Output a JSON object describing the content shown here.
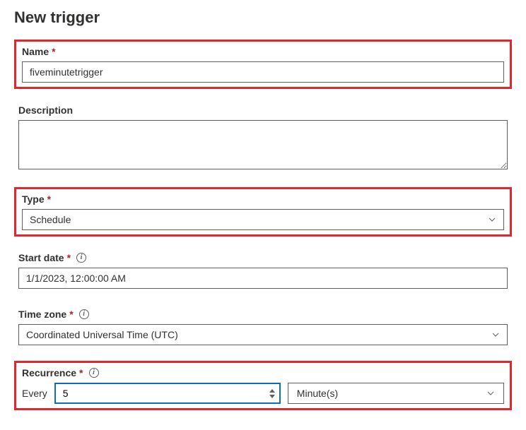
{
  "page": {
    "title": "New trigger"
  },
  "fields": {
    "name": {
      "label": "Name",
      "required": "*",
      "value": "fiveminutetrigger"
    },
    "description": {
      "label": "Description",
      "value": ""
    },
    "type": {
      "label": "Type",
      "required": "*",
      "value": "Schedule"
    },
    "start_date": {
      "label": "Start date",
      "required": "*",
      "value": "1/1/2023, 12:00:00 AM"
    },
    "time_zone": {
      "label": "Time zone",
      "required": "*",
      "value": "Coordinated Universal Time (UTC)"
    },
    "recurrence": {
      "label": "Recurrence",
      "required": "*",
      "every_label": "Every",
      "interval": "5",
      "unit": "Minute(s)"
    }
  },
  "icons": {
    "info": "i"
  }
}
